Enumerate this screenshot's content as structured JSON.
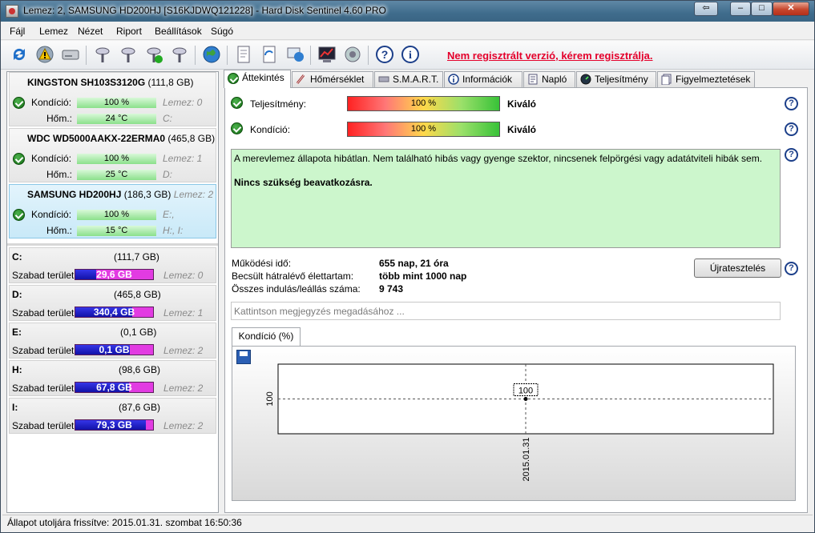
{
  "window": {
    "title": "Lemez: 2, SAMSUNG HD200HJ [S16KJDWQ121228]  -  Hard Disk Sentinel 4.60 PRO",
    "btn_back": "⇦",
    "btn_min": "–",
    "btn_max": "□",
    "btn_close": "✕"
  },
  "menu": [
    "Fájl",
    "Lemez",
    "Nézet",
    "Riport",
    "Beállítások",
    "Súgó"
  ],
  "toolbar": {
    "register_text": "Nem regisztrált verzió, kérem regisztrálja."
  },
  "disks": [
    {
      "name": "KINGSTON SH103S3120G",
      "size": "(111,8 GB)",
      "health_label": "Kondíció:",
      "health": "100 %",
      "health_value": 100,
      "disk_label": "Lemez: 0",
      "temp_label": "Hőm.:",
      "temp": "24 °C",
      "drives": "C:"
    },
    {
      "name": "WDC WD5000AAKX-22ERMA0",
      "size": "(465,8 GB)",
      "health_label": "Kondíció:",
      "health": "100 %",
      "health_value": 100,
      "disk_label": "Lemez: 1",
      "temp_label": "Hőm.:",
      "temp": "25 °C",
      "drives": "D:"
    },
    {
      "name": "SAMSUNG HD200HJ",
      "size": "(186,3 GB)",
      "disk_label": "Lemez: 2",
      "health_label": "Kondíció:",
      "health": "100 %",
      "health_value": 100,
      "temp_label": "Hőm.:",
      "temp": "15 °C",
      "drives": "H:, I:",
      "drives_extra": "E:,"
    }
  ],
  "volumes": [
    {
      "letter": "C:",
      "size": "(111,7 GB)",
      "free_label": "Szabad terület",
      "free": "29,6 GB",
      "free_fraction": 0.27,
      "disk": "Lemez: 0"
    },
    {
      "letter": "D:",
      "size": "(465,8 GB)",
      "free_label": "Szabad terület",
      "free": "340,4 GB",
      "free_fraction": 0.73,
      "disk": "Lemez: 1"
    },
    {
      "letter": "E:",
      "size": "(0,1 GB)",
      "free_label": "Szabad terület",
      "free": "0,1 GB",
      "free_fraction": 1.0,
      "disk": "Lemez: 2"
    },
    {
      "letter": "H:",
      "size": "(98,6 GB)",
      "free_label": "Szabad terület",
      "free": "67,8 GB",
      "free_fraction": 0.69,
      "disk": "Lemez: 2"
    },
    {
      "letter": "I:",
      "size": "(87,6 GB)",
      "free_label": "Szabad terület",
      "free": "79,3 GB",
      "free_fraction": 0.91,
      "disk": "Lemez: 2"
    }
  ],
  "tabs": [
    "Áttekintés",
    "Hőmérséklet",
    "S.M.A.R.T.",
    "Információk",
    "Napló",
    "Teljesítmény",
    "Figyelmeztetések"
  ],
  "overview": {
    "perf_label": "Teljesítmény:",
    "perf_value": "100 %",
    "perf_fraction": 1.0,
    "perf_rating": "Kiváló",
    "health_label": "Kondíció:",
    "health_value": "100 %",
    "health_fraction": 1.0,
    "health_rating": "Kiváló",
    "message": "A merevlemez állapota hibátlan. Nem található hibás vagy gyenge szektor, nincsenek felpörgési vagy adatátviteli hibák sem.",
    "action": "Nincs szükség beavatkozásra.",
    "uptime_label": "Működési idő:",
    "uptime": "655 nap, 21 óra",
    "remaining_label": "Becsült hátralévő élettartam:",
    "remaining": "több mint 1000 nap",
    "starts_label": "Összes indulás/leállás száma:",
    "starts": "9 743",
    "retest_button": "Újratesztelés",
    "note_placeholder": "Kattintson megjegyzés megadásához ...",
    "chart_tab": "Kondíció  (%)",
    "help": "?"
  },
  "chart_data": {
    "type": "line",
    "x": [
      "2015.01.31"
    ],
    "series": [
      {
        "values": [
          100
        ]
      }
    ],
    "ylim": [
      100,
      100
    ],
    "y_tick": "100",
    "data_label": "100",
    "grid": true
  },
  "status": {
    "text": "Állapot utoljára frissítve: 2015.01.31. szombat 16:50:36"
  },
  "colors": {
    "register_red": "#e4002b",
    "volume_used": "#e23be2",
    "volume_free": "#2020c0",
    "ok_green": "#1d8a1d",
    "message_bg": "#ccf6cc"
  }
}
